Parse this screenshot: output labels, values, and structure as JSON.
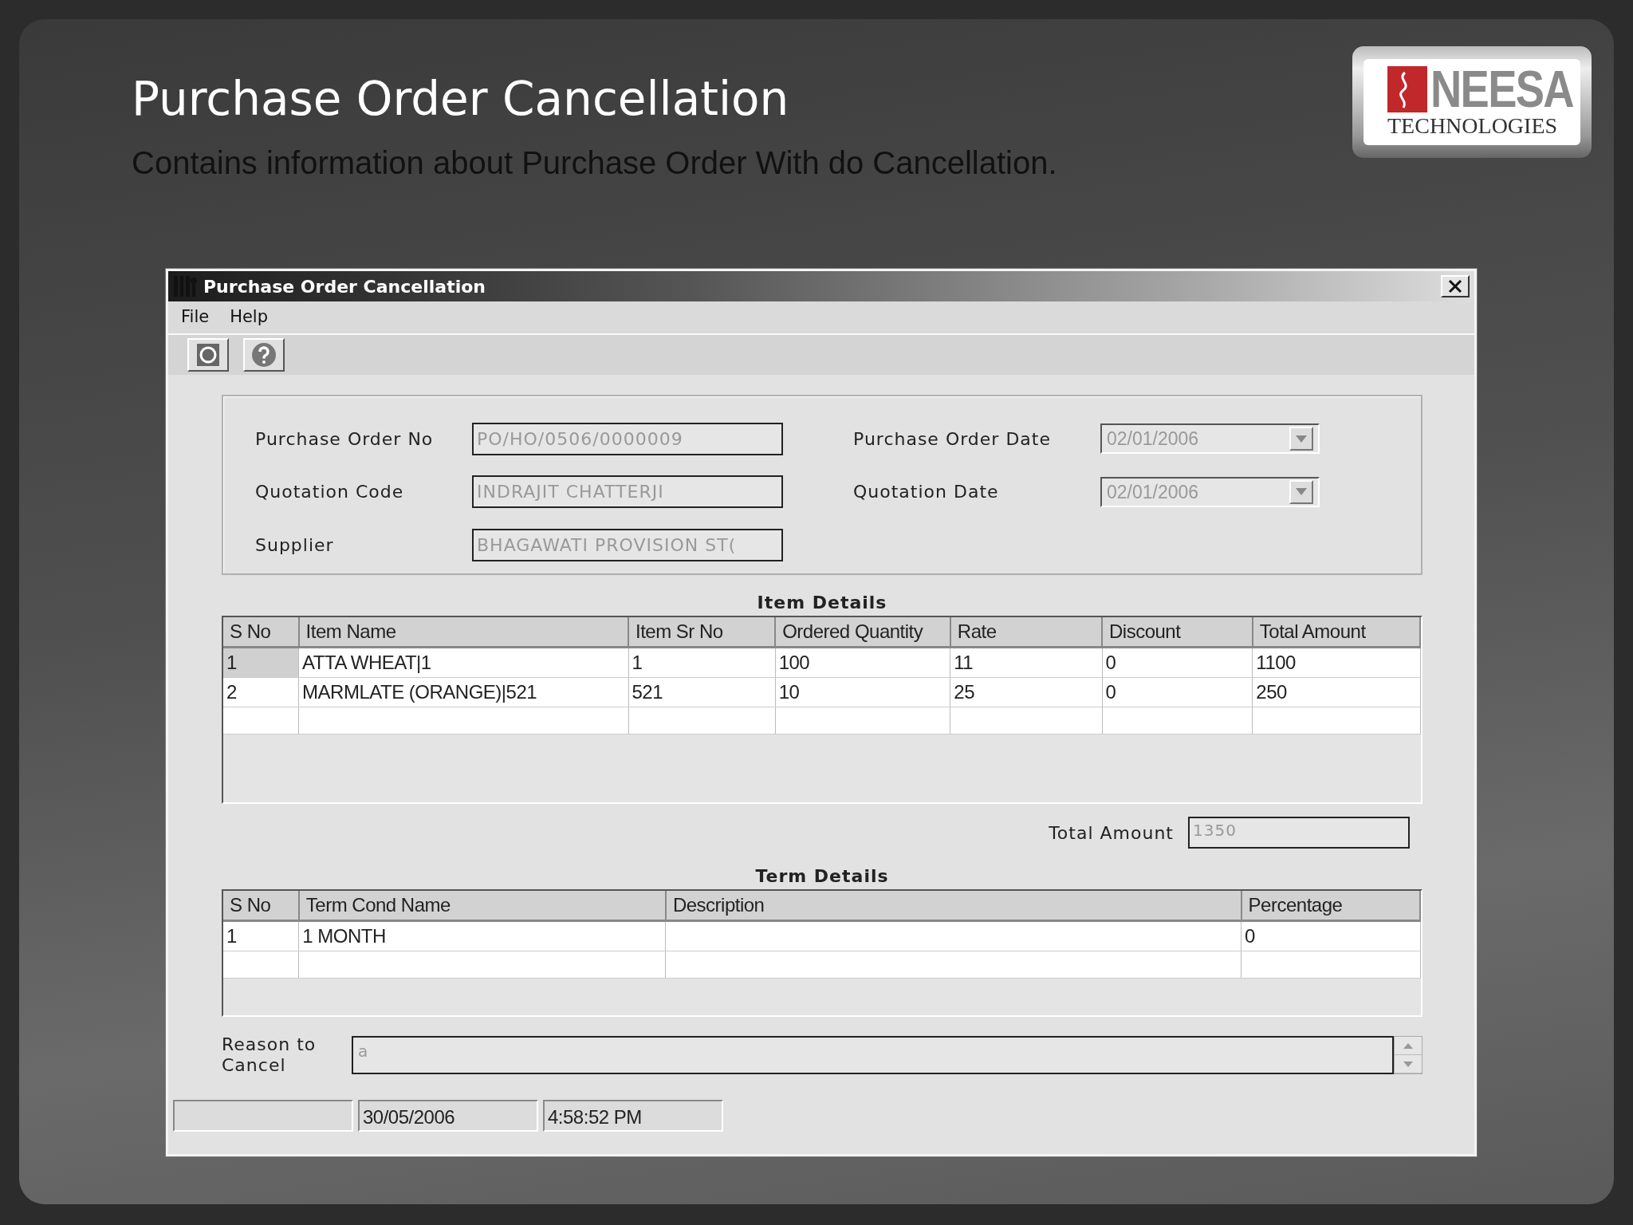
{
  "slide": {
    "title": "Purchase Order Cancellation",
    "subtitle": "Contains information about Purchase Order With do Cancellation."
  },
  "logo": {
    "name": "NEESA",
    "tagline": "TECHNOLOGIES"
  },
  "window": {
    "title": "Purchase Order Cancellation"
  },
  "menu": [
    "File",
    "Help"
  ],
  "fields": [
    {
      "label": "Purchase Order No",
      "value": "PO/HO/0506/0000009",
      "kind": "text",
      "disabled": true
    },
    {
      "label": "Purchase Order Date",
      "value": "02/01/2006",
      "kind": "date",
      "disabled": true
    },
    {
      "label": "Quotation Code",
      "value": "INDRAJIT CHATTERJI",
      "kind": "text",
      "disabled": true
    },
    {
      "label": "Quotation Date",
      "value": "02/01/2006",
      "kind": "date",
      "disabled": true
    },
    {
      "label": "Supplier",
      "value": "BHAGAWATI PROVISION ST(",
      "kind": "text",
      "disabled": true
    }
  ],
  "items": {
    "title": "Item Details",
    "columns": [
      "S No",
      "Item Name",
      "Item Sr No",
      "Ordered Quantity",
      "Rate",
      "Discount",
      "Total Amount"
    ],
    "rows": [
      {
        "cells": [
          "1",
          "ATTA WHEAT|1",
          "1",
          "100",
          "11",
          "0",
          "1100"
        ],
        "selected": true
      },
      {
        "cells": [
          "2",
          "MARMLATE (ORANGE)|521",
          "521",
          "10",
          "25",
          "0",
          "250"
        ],
        "selected": false
      }
    ]
  },
  "total": {
    "label": "Total Amount",
    "value": "1350",
    "disabled": true
  },
  "terms": {
    "title": "Term Details",
    "columns": [
      "S No",
      "Term Cond Name",
      "Description",
      "Percentage"
    ],
    "rows": [
      {
        "cells": [
          "1",
          "1 MONTH",
          "",
          "0"
        ],
        "selected": false
      }
    ]
  },
  "reason": {
    "label": "Reason to Cancel",
    "value": "a",
    "disabled": true
  },
  "status_bar": [
    "30/05/2006",
    "4:58:52 PM"
  ]
}
